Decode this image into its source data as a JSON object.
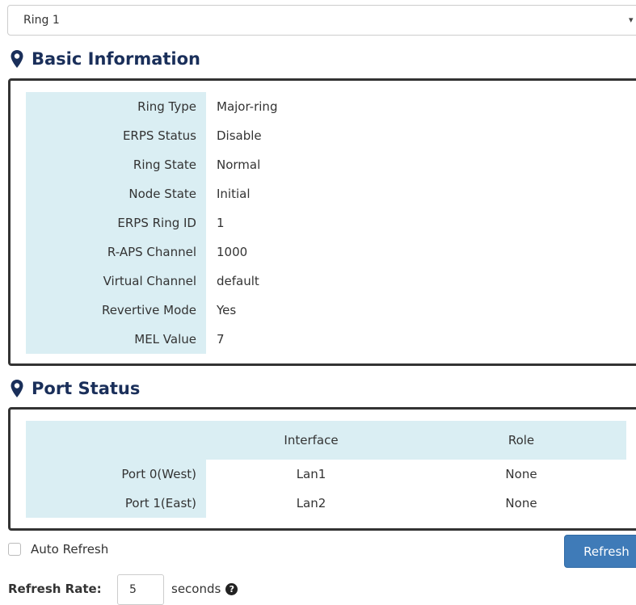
{
  "ring_select": {
    "selected": "Ring 1",
    "caret": "▾"
  },
  "basic_info": {
    "title": "Basic Information",
    "rows": [
      {
        "label": "Ring Type",
        "value": "Major-ring"
      },
      {
        "label": "ERPS Status",
        "value": "Disable"
      },
      {
        "label": "Ring State",
        "value": "Normal"
      },
      {
        "label": "Node State",
        "value": "Initial"
      },
      {
        "label": "ERPS Ring ID",
        "value": "1"
      },
      {
        "label": "R-APS Channel",
        "value": "1000"
      },
      {
        "label": "Virtual Channel",
        "value": "default"
      },
      {
        "label": "Revertive Mode",
        "value": "Yes"
      },
      {
        "label": "MEL Value",
        "value": "7"
      }
    ]
  },
  "port_status": {
    "title": "Port Status",
    "columns": [
      "Interface",
      "Role"
    ],
    "rows": [
      {
        "port": "Port 0(West)",
        "interface": "Lan1",
        "role": "None"
      },
      {
        "port": "Port 1(East)",
        "interface": "Lan2",
        "role": "None"
      }
    ]
  },
  "controls": {
    "auto_refresh_label": "Auto Refresh",
    "refresh_button": "Refresh",
    "rate_label": "Refresh Rate:",
    "rate_value": "5",
    "rate_unit": "seconds",
    "help_glyph": "?"
  },
  "colors": {
    "title": "#1a2f5a",
    "label_bg": "#daeef3",
    "button": "#3f7bb8"
  }
}
